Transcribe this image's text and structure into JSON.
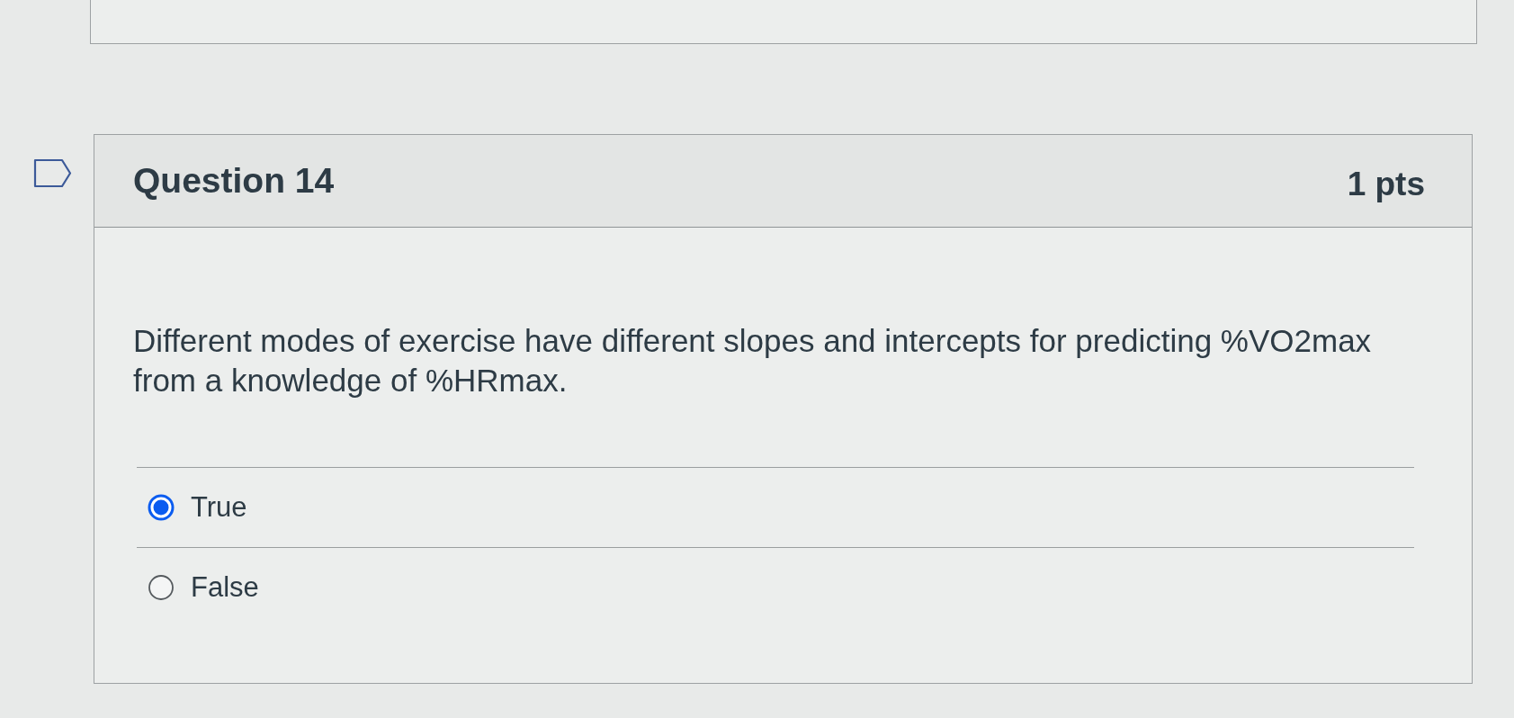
{
  "question": {
    "flagged": false,
    "title": "Question 14",
    "points": "1 pts",
    "text": "Different modes of exercise have different slopes and intercepts for predicting %VO2max from a knowledge of %HRmax.",
    "answers": [
      {
        "label": "True",
        "selected": true
      },
      {
        "label": "False",
        "selected": false
      }
    ]
  }
}
